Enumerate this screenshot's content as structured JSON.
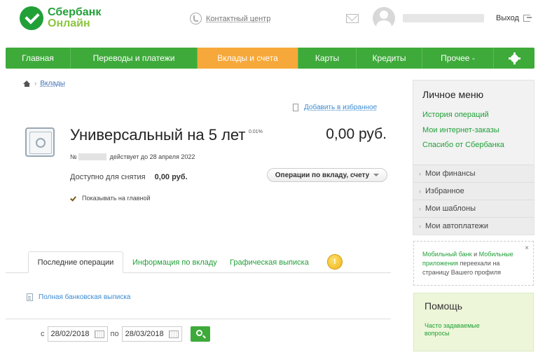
{
  "header": {
    "logo_line1": "Сбербанк",
    "logo_line2": "Онлайн",
    "contact_center": "Контактный центр",
    "logout": "Выход"
  },
  "nav": {
    "items": [
      "Главная",
      "Переводы и платежи",
      "Вклады и счета",
      "Карты",
      "Кредиты",
      "Прочее -"
    ],
    "active_index": 2,
    "settings_icon": "gear-icon"
  },
  "breadcrumb": {
    "current": "Вклады"
  },
  "favorites": "Добавить в избранное",
  "product": {
    "title": "Универсальный на 5 лет",
    "rate": "0.01%",
    "balance": "0,00 руб.",
    "account_prefix": "№",
    "valid_until": "действует до 28 апреля 2022",
    "available_label": "Доступно для снятия",
    "available_value": "0,00 руб.",
    "operations_button": "Операции по вкладу, счету",
    "show_on_main": "Показывать на главной",
    "show_on_main_checked": true
  },
  "tabs": {
    "last_operations": "Последние операции",
    "deposit_info": "Информация по вкладу",
    "graphic_statement": "Графическая выписка",
    "badge": "!"
  },
  "statement_link": "Полная банковская выписка",
  "date_filter": {
    "from_label": "с",
    "from_value": "28/02/2018",
    "to_label": "по",
    "to_value": "28/03/2018"
  },
  "sidebar": {
    "personal_menu_title": "Личное меню",
    "links": [
      "История операций",
      "Мои интернет-заказы",
      "Спасибо от Сбербанка"
    ],
    "items": [
      "Мои финансы",
      "Избранное",
      "Мои шаблоны",
      "Мои автоплатежи"
    ],
    "notice": {
      "link1": "Мобильный банк",
      "and": " и ",
      "link2": "Мобильные приложения",
      "text": " переехали на страницу Вашего профиля",
      "close": "×"
    },
    "help_title": "Помощь",
    "faq": "Часто задаваемые вопросы"
  },
  "colors": {
    "brand_green": "#3eaa3a",
    "active_tab": "#f7a83a",
    "link_green": "#21a038"
  }
}
